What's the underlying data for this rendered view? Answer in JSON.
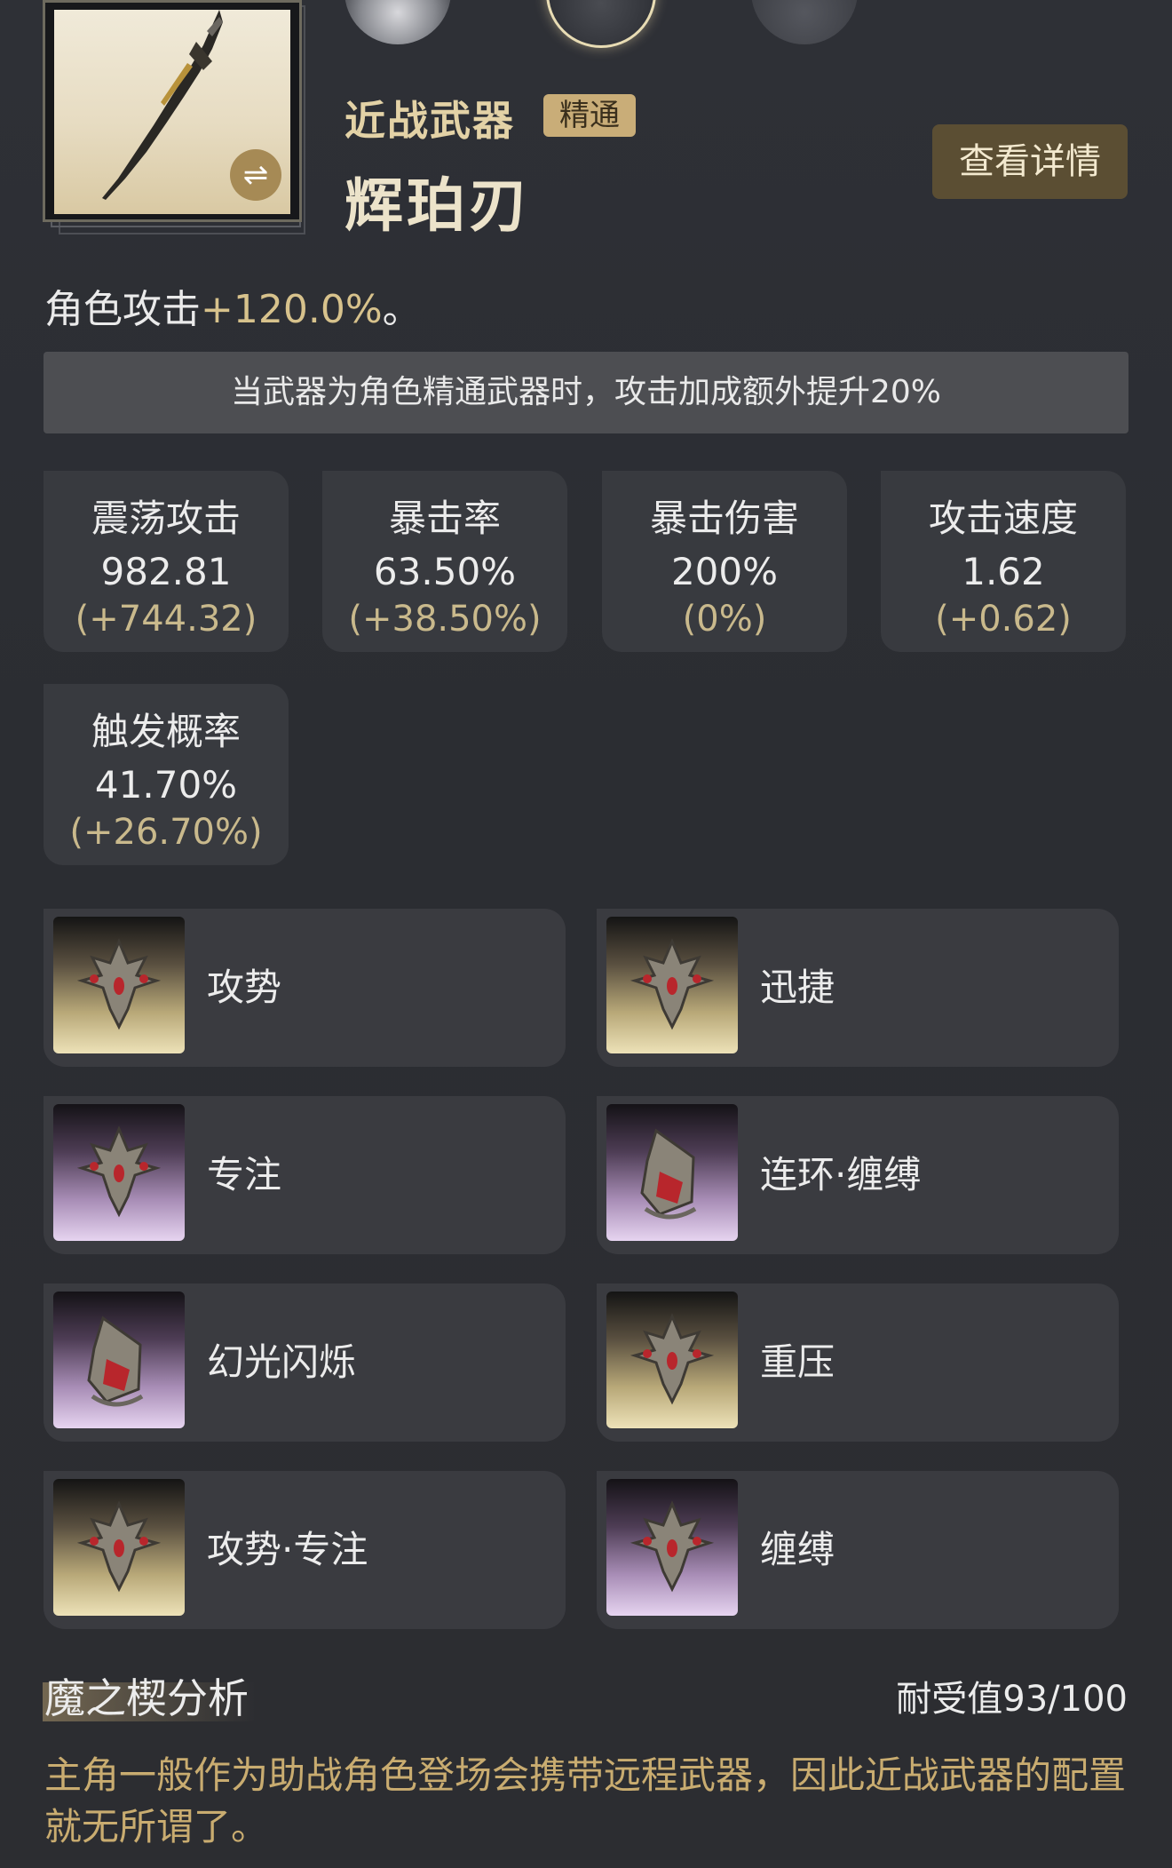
{
  "weapon": {
    "type_label": "近战武器",
    "badge": "精通",
    "name": "辉珀刃",
    "swap_icon": "swap-arrows-icon",
    "detail_button": "查看详情"
  },
  "attack_bonus": {
    "prefix": "角色攻击",
    "value": "+120.0%",
    "suffix": "。"
  },
  "note": "当武器为角色精通武器时，攻击加成额外提升20%",
  "stats": [
    {
      "label": "震荡攻击",
      "value": "982.81",
      "delta": "(+744.32)"
    },
    {
      "label": "暴击率",
      "value": "63.50%",
      "delta": "(+38.50%)"
    },
    {
      "label": "暴击伤害",
      "value": "200%",
      "delta": "(0%)"
    },
    {
      "label": "攻击速度",
      "value": "1.62",
      "delta": "(+0.62)"
    },
    {
      "label": "触发概率",
      "value": "41.70%",
      "delta": "(+26.70%)"
    }
  ],
  "mods": [
    {
      "name": "攻势",
      "rarity": "gold",
      "icon": "demon-wedge-icon"
    },
    {
      "name": "迅捷",
      "rarity": "gold",
      "icon": "demon-wedge-icon"
    },
    {
      "name": "专注",
      "rarity": "purple",
      "icon": "demon-wedge-icon"
    },
    {
      "name": "连环·缠缚",
      "rarity": "purple",
      "icon": "chain-mask-icon"
    },
    {
      "name": "幻光闪烁",
      "rarity": "purple",
      "icon": "chain-mask-icon"
    },
    {
      "name": "重压",
      "rarity": "gold",
      "icon": "demon-wedge-icon"
    },
    {
      "name": "攻势·专注",
      "rarity": "gold",
      "icon": "demon-wedge-icon"
    },
    {
      "name": "缠缚",
      "rarity": "purple",
      "icon": "demon-wedge-icon"
    }
  ],
  "analysis": {
    "title": "魔之楔分析",
    "tolerance": "耐受值93/100",
    "text": "主角一般作为助战角色登场会携带远程武器，因此近战武器的配置就无所谓了。"
  },
  "colors": {
    "accent_gold": "#c9ad78",
    "highlight": "#d7c28c",
    "analysis_text": "#c9ac70"
  }
}
